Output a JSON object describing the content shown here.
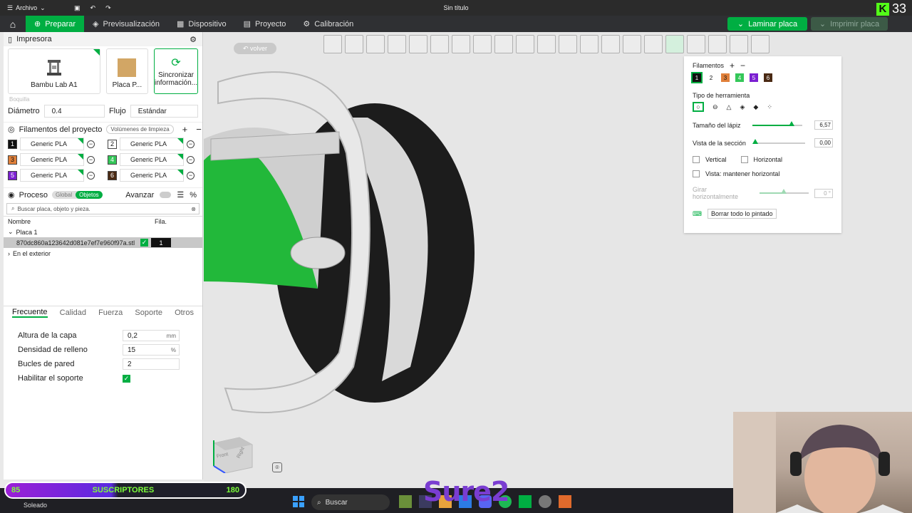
{
  "titlebar": {
    "menu_label": "Archivo",
    "title": "Sin título",
    "kick_count": "33",
    "kick_letter": "K"
  },
  "topnav": {
    "tabs": [
      {
        "label": "Preparar",
        "icon": "plus-icon"
      },
      {
        "label": "Previsualización",
        "icon": "layers-icon"
      },
      {
        "label": "Dispositivo",
        "icon": "device-icon"
      },
      {
        "label": "Proyecto",
        "icon": "project-icon"
      },
      {
        "label": "Calibración",
        "icon": "gear-icon"
      }
    ],
    "slice_label": "Laminar placa",
    "print_label": "Imprimir placa"
  },
  "printer": {
    "section_title": "Impresora",
    "printer_name": "Bambu Lab A1",
    "plate_name": "Placa P...",
    "sync_label": "Sincronizar información...",
    "nozzle_label": "Boquilla",
    "diameter_label": "Diámetro",
    "diameter_value": "0.4",
    "flow_label": "Flujo",
    "flow_value": "Estándar"
  },
  "filaments": {
    "section_title": "Filamentos del proyecto",
    "flush_label": "Volúmenes de limpieza",
    "items": [
      {
        "num": "1",
        "name": "Generic PLA",
        "color": "#111111",
        "text": "#ffffff"
      },
      {
        "num": "2",
        "name": "Generic PLA",
        "color": "#ffffff",
        "text": "#111111"
      },
      {
        "num": "3",
        "name": "Generic PLA",
        "color": "#e0803a",
        "text": "#111111"
      },
      {
        "num": "4",
        "name": "Generic PLA",
        "color": "#34c759",
        "text": "#ffffff"
      },
      {
        "num": "5",
        "name": "Generic PLA",
        "color": "#7b1fd1",
        "text": "#ffffff"
      },
      {
        "num": "6",
        "name": "Generic PLA",
        "color": "#4a2a14",
        "text": "#ffffff"
      }
    ]
  },
  "process": {
    "section_title": "Proceso",
    "global_label": "Global",
    "objects_label": "Objetos",
    "advanced_label": "Avanzar",
    "search_placeholder": "Buscar placa, objeto y pieza.",
    "col_name": "Nombre",
    "col_fil": "Fila.",
    "plate_label": "Placa 1",
    "object_name": "870dc860a123642d081e7ef7e960f97a.stl",
    "object_fil": "1",
    "outside_label": "En el exterior",
    "tabs": [
      "Frecuente",
      "Calidad",
      "Fuerza",
      "Soporte",
      "Otros"
    ],
    "params": [
      {
        "label": "Altura de la capa",
        "value": "0,2",
        "unit": "mm"
      },
      {
        "label": "Densidad de relleno",
        "value": "15",
        "unit": "%"
      },
      {
        "label": "Bucles de pared",
        "value": "2",
        "unit": ""
      }
    ],
    "support_label": "Habilitar el soporte"
  },
  "viewport": {
    "back_label": "volver",
    "cube_labels": {
      "front": "Front",
      "right": "Right"
    }
  },
  "paint": {
    "filaments_label": "Filamentos",
    "swatches": [
      {
        "num": "1",
        "color": "#111111",
        "text": "#ffffff"
      },
      {
        "num": "2",
        "color": "#ffffff",
        "text": "#111111"
      },
      {
        "num": "3",
        "color": "#e0803a",
        "text": "#111111"
      },
      {
        "num": "4",
        "color": "#34c759",
        "text": "#ffffff"
      },
      {
        "num": "5",
        "color": "#7b1fd1",
        "text": "#ffffff"
      },
      {
        "num": "6",
        "color": "#4a2a14",
        "text": "#ffffff"
      }
    ],
    "tool_type_label": "Tipo de herramienta",
    "pen_size_label": "Tamaño del lápiz",
    "pen_size_value": "6,57",
    "pen_size_level": 0.78,
    "section_view_label": "Vista de la sección",
    "section_view_value": "0,00",
    "section_view_level": 0.0,
    "vertical_label": "Vertical",
    "horizontal_label": "Horizontal",
    "keep_horizontal_label": "Vista: mantener horizontal",
    "rotate_label": "Girar horizontalmente",
    "rotate_value": "0 °",
    "rotate_level": 0.5,
    "clear_label": "Borrar todo lo pintado"
  },
  "taskbar": {
    "sub_min": "85",
    "sub_label": "SUSCRIPTORES",
    "sub_max": "180",
    "sub_progress": 0.47,
    "weather": "Soleado",
    "search_label": "Buscar",
    "brand": "Sure2"
  },
  "colors": {
    "accent": "#00ae42",
    "dark": "#2f3033"
  }
}
